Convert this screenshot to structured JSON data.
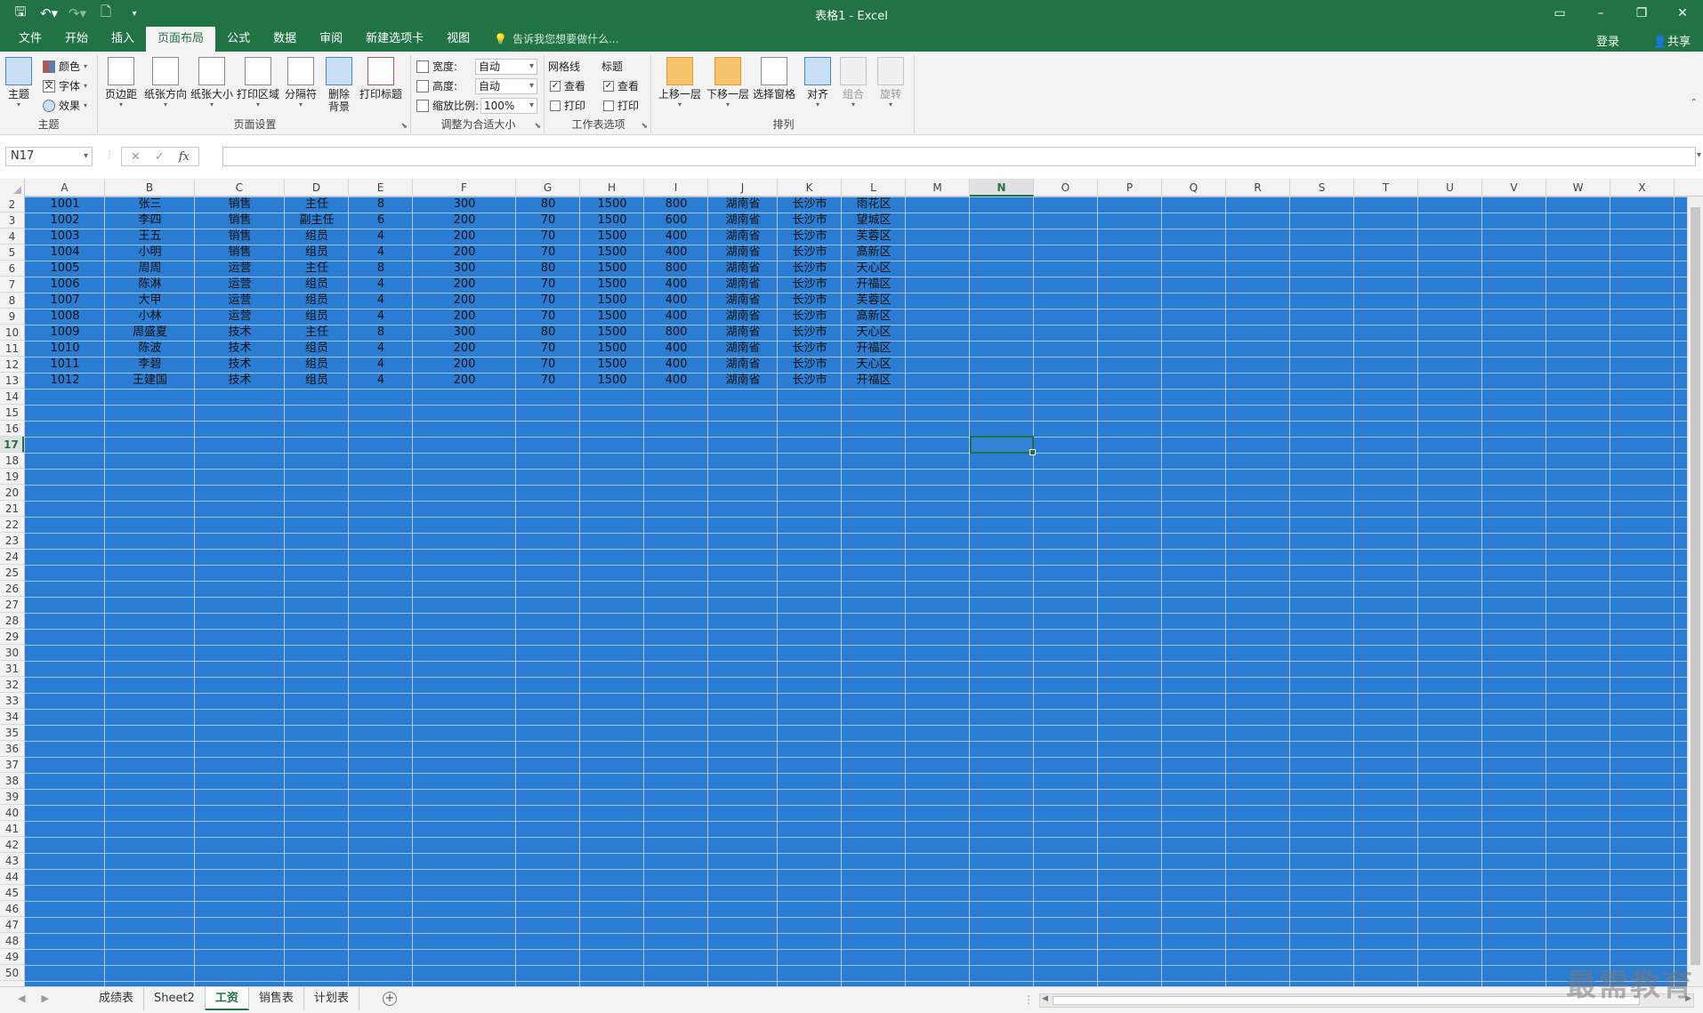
{
  "window": {
    "title": "表格1 - Excel",
    "signin": "登录",
    "share": "共享"
  },
  "tabs": [
    "文件",
    "开始",
    "插入",
    "页面布局",
    "公式",
    "数据",
    "审阅",
    "新建选项卡",
    "视图"
  ],
  "active_tab": 3,
  "tell_me": "告诉我您想要做什么...",
  "ribbon": {
    "theme": {
      "label": "主题",
      "big": "主题",
      "colors": "颜色",
      "fonts": "字体",
      "effects": "效果"
    },
    "page_setup": {
      "label": "页面设置",
      "margins": "页边距",
      "orientation": "纸张方向",
      "size": "纸张大小",
      "print_area": "打印区域",
      "breaks": "分隔符",
      "background_1": "删除",
      "background_2": "背景",
      "print_titles": "打印标题"
    },
    "scale": {
      "label": "调整为合适大小",
      "width_label": "宽度:",
      "width_value": "自动",
      "height_label": "高度:",
      "height_value": "自动",
      "scale_label": "缩放比例:",
      "scale_value": "100%"
    },
    "sheet_options": {
      "label": "工作表选项",
      "gridlines": "网格线",
      "headings": "标题",
      "view": "查看",
      "print": "打印"
    },
    "arrange": {
      "label": "排列",
      "bring_forward": "上移一层",
      "send_backward": "下移一层",
      "selection_pane": "选择窗格",
      "align": "对齐",
      "group": "组合",
      "rotate": "旋转"
    }
  },
  "formula_bar": {
    "name_box": "N17",
    "formula": ""
  },
  "columns": [
    "A",
    "B",
    "C",
    "D",
    "E",
    "F",
    "G",
    "H",
    "I",
    "J",
    "K",
    "L",
    "M",
    "N",
    "O",
    "P",
    "Q",
    "R",
    "S",
    "T",
    "U",
    "V",
    "W",
    "X"
  ],
  "selected_column": "N",
  "first_row": 2,
  "last_row": 50,
  "selected_row": 17,
  "table_rows": [
    [
      "1001",
      "张三",
      "销售",
      "主任",
      "8",
      "300",
      "80",
      "1500",
      "800",
      "湖南省",
      "长沙市",
      "雨花区"
    ],
    [
      "1002",
      "李四",
      "销售",
      "副主任",
      "6",
      "200",
      "70",
      "1500",
      "600",
      "湖南省",
      "长沙市",
      "望城区"
    ],
    [
      "1003",
      "王五",
      "销售",
      "组员",
      "4",
      "200",
      "70",
      "1500",
      "400",
      "湖南省",
      "长沙市",
      "芙蓉区"
    ],
    [
      "1004",
      "小明",
      "销售",
      "组员",
      "4",
      "200",
      "70",
      "1500",
      "400",
      "湖南省",
      "长沙市",
      "高新区"
    ],
    [
      "1005",
      "周周",
      "运营",
      "主任",
      "8",
      "300",
      "80",
      "1500",
      "800",
      "湖南省",
      "长沙市",
      "天心区"
    ],
    [
      "1006",
      "陈淋",
      "运营",
      "组员",
      "4",
      "200",
      "70",
      "1500",
      "400",
      "湖南省",
      "长沙市",
      "开福区"
    ],
    [
      "1007",
      "大甲",
      "运营",
      "组员",
      "4",
      "200",
      "70",
      "1500",
      "400",
      "湖南省",
      "长沙市",
      "芙蓉区"
    ],
    [
      "1008",
      "小林",
      "运营",
      "组员",
      "4",
      "200",
      "70",
      "1500",
      "400",
      "湖南省",
      "长沙市",
      "高新区"
    ],
    [
      "1009",
      "周盛夏",
      "技术",
      "主任",
      "8",
      "300",
      "80",
      "1500",
      "800",
      "湖南省",
      "长沙市",
      "天心区"
    ],
    [
      "1010",
      "陈波",
      "技术",
      "组员",
      "4",
      "200",
      "70",
      "1500",
      "400",
      "湖南省",
      "长沙市",
      "开福区"
    ],
    [
      "1011",
      "李碧",
      "技术",
      "组员",
      "4",
      "200",
      "70",
      "1500",
      "400",
      "湖南省",
      "长沙市",
      "天心区"
    ],
    [
      "1012",
      "王建国",
      "技术",
      "组员",
      "4",
      "200",
      "70",
      "1500",
      "400",
      "湖南省",
      "长沙市",
      "开福区"
    ]
  ],
  "sheets": [
    "成绩表",
    "Sheet2",
    "工资",
    "销售表",
    "计划表"
  ],
  "active_sheet": 2,
  "watermark": "最需教育",
  "colors": {
    "accent": "#217346",
    "selection_fill": "#2a7dd2"
  }
}
